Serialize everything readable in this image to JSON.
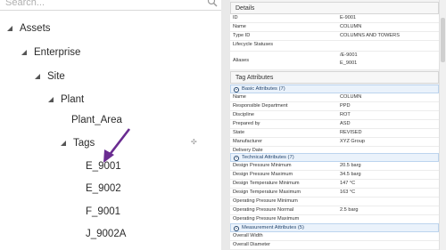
{
  "search": {
    "placeholder": "Search..."
  },
  "tree": [
    {
      "label": "Assets"
    },
    {
      "label": "Enterprise"
    },
    {
      "label": "Site"
    },
    {
      "label": "Plant"
    },
    {
      "label": "Plant_Area"
    },
    {
      "label": "Tags"
    },
    {
      "label": "E_9001"
    },
    {
      "label": "E_9002"
    },
    {
      "label": "F_9001"
    },
    {
      "label": "J_9002A"
    }
  ],
  "details": {
    "title": "Details",
    "rows": [
      {
        "k": "ID",
        "v": "E-9001"
      },
      {
        "k": "Name",
        "v": "COLUMN"
      },
      {
        "k": "Type ID",
        "v": "COLUMNS AND TOWERS"
      },
      {
        "k": "Lifecycle Statuses",
        "v": ""
      },
      {
        "k": "Aliases",
        "v": "/E-9001",
        "v2": "E_9001"
      }
    ]
  },
  "tag_attributes": {
    "title": "Tag Attributes",
    "basic": {
      "title": "Basic Attributes (7)",
      "rows": [
        {
          "k": "Name",
          "v": "COLUMN"
        },
        {
          "k": "Responsible Department",
          "v": "PPD"
        },
        {
          "k": "Discipline",
          "v": "ROT"
        },
        {
          "k": "Prepared by",
          "v": "ASD"
        },
        {
          "k": "State",
          "v": "REVISED"
        },
        {
          "k": "Manufacturer",
          "v": "XYZ Group"
        },
        {
          "k": "Delivery Date",
          "v": ""
        }
      ]
    },
    "technical": {
      "title": "Technical Attributes (7)",
      "rows": [
        {
          "k": "Design Pressure Minimum",
          "v": "20.5 barg"
        },
        {
          "k": "Design Pressure Maximum",
          "v": "34.5 barg"
        },
        {
          "k": "Design Temperature Minimum",
          "v": "147 °C"
        },
        {
          "k": "Design Temperature Maximum",
          "v": "163 °C"
        },
        {
          "k": "Operating Pressure Minimum",
          "v": ""
        },
        {
          "k": "Operating Pressure Normal",
          "v": "2.5 barg"
        },
        {
          "k": "Operating Pressure Maximum",
          "v": ""
        }
      ]
    },
    "measurement": {
      "title": "Measurement Attributes (5)",
      "rows": [
        {
          "k": "Overall Width",
          "v": ""
        },
        {
          "k": "Overall Diameter",
          "v": ""
        }
      ]
    }
  },
  "colors": {
    "arrow": "#6a2c91",
    "section_bg": "#eaf2fb",
    "section_text": "#23456e"
  }
}
